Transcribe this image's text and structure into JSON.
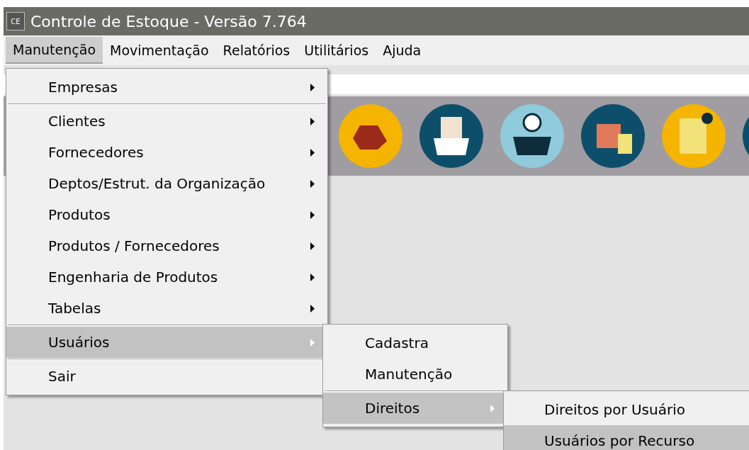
{
  "window": {
    "title": "Controle de Estoque - Versão 7.764",
    "app_icon": "CE"
  },
  "menu_bar": [
    {
      "label": "Manutenção",
      "selected": true
    },
    {
      "label": "Movimentação",
      "selected": false
    },
    {
      "label": "Relatórios",
      "selected": false
    },
    {
      "label": "Utilitários",
      "selected": false
    },
    {
      "label": "Ajuda",
      "selected": false
    }
  ],
  "menus": [
    {
      "items": [
        {
          "kind": "item",
          "label": "Empresas",
          "submenu": true,
          "selected": false
        },
        {
          "kind": "separator"
        },
        {
          "kind": "item",
          "label": "Clientes",
          "submenu": true,
          "selected": false
        },
        {
          "kind": "item",
          "label": "Fornecedores",
          "submenu": true,
          "selected": false
        },
        {
          "kind": "item",
          "label": "Deptos/Estrut. da Organização",
          "submenu": true,
          "selected": false
        },
        {
          "kind": "item",
          "label": "Produtos",
          "submenu": true,
          "selected": false
        },
        {
          "kind": "item",
          "label": "Produtos / Fornecedores",
          "submenu": true,
          "selected": false
        },
        {
          "kind": "item",
          "label": "Engenharia de Produtos",
          "submenu": true,
          "selected": false
        },
        {
          "kind": "item",
          "label": "Tabelas",
          "submenu": true,
          "selected": false
        },
        {
          "kind": "separator"
        },
        {
          "kind": "item",
          "label": "Usuários",
          "submenu": true,
          "selected": true
        },
        {
          "kind": "separator"
        },
        {
          "kind": "item",
          "label": "Sair",
          "submenu": false,
          "selected": false
        }
      ]
    },
    {
      "items": [
        {
          "kind": "item",
          "label": "Cadastra",
          "submenu": false,
          "selected": false
        },
        {
          "kind": "item",
          "label": "Manutenção",
          "submenu": false,
          "selected": false
        },
        {
          "kind": "separator"
        },
        {
          "kind": "item",
          "label": "Direitos",
          "submenu": true,
          "selected": true
        }
      ]
    },
    {
      "items": [
        {
          "kind": "item",
          "label": "Direitos por Usuário",
          "submenu": false,
          "selected": false
        },
        {
          "kind": "item",
          "label": "Usuários por Recurso",
          "submenu": false,
          "selected": true
        }
      ]
    }
  ]
}
